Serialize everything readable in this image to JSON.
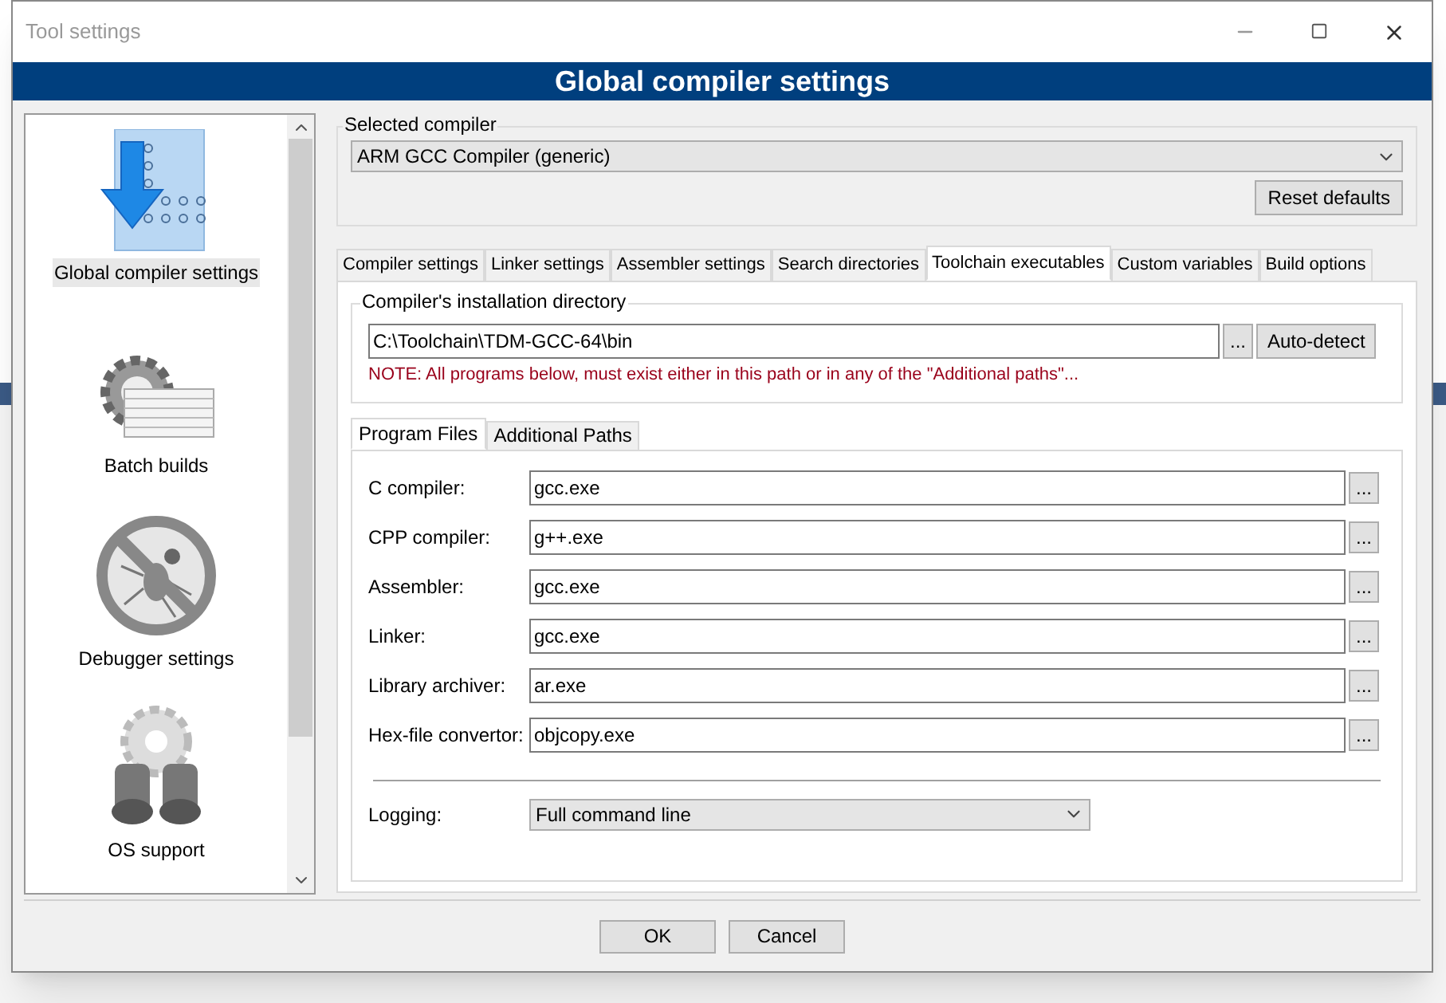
{
  "window": {
    "title": "Tool settings",
    "header": "Global compiler settings"
  },
  "sidebar": {
    "items": [
      {
        "label": "Global compiler settings",
        "kind": "compiler",
        "selected": true
      },
      {
        "label": "Batch builds",
        "kind": "batch",
        "selected": false
      },
      {
        "label": "Debugger settings",
        "kind": "debugger",
        "selected": false
      },
      {
        "label": "OS support",
        "kind": "os",
        "selected": false
      }
    ]
  },
  "selected_compiler": {
    "legend": "Selected compiler",
    "value": "ARM GCC Compiler (generic)",
    "reset_button": "Reset defaults"
  },
  "tabs": [
    {
      "label": "Compiler settings",
      "selected": false
    },
    {
      "label": "Linker settings",
      "selected": false
    },
    {
      "label": "Assembler settings",
      "selected": false
    },
    {
      "label": "Search directories",
      "selected": false
    },
    {
      "label": "Toolchain executables",
      "selected": true
    },
    {
      "label": "Custom variables",
      "selected": false
    },
    {
      "label": "Build options",
      "selected": false
    }
  ],
  "install_dir": {
    "legend": "Compiler's installation directory",
    "value": "C:\\Toolchain\\TDM-GCC-64\\bin",
    "browse_button": "...",
    "autodetect_button": "Auto-detect",
    "note": "NOTE: All programs below, must exist either in this path or in any of the \"Additional paths\"..."
  },
  "subtabs": [
    {
      "label": "Program Files",
      "selected": true
    },
    {
      "label": "Additional Paths",
      "selected": false
    }
  ],
  "programs": [
    {
      "label": "C compiler:",
      "value": "gcc.exe",
      "browse_button": "..."
    },
    {
      "label": "CPP compiler:",
      "value": "g++.exe",
      "browse_button": "..."
    },
    {
      "label": "Assembler:",
      "value": "gcc.exe",
      "browse_button": "..."
    },
    {
      "label": "Linker:",
      "value": "gcc.exe",
      "browse_button": "..."
    },
    {
      "label": "Library archiver:",
      "value": "ar.exe",
      "browse_button": "..."
    },
    {
      "label": "Hex-file convertor:",
      "value": "objcopy.exe",
      "browse_button": "..."
    }
  ],
  "logging": {
    "label": "Logging:",
    "value": "Full command line"
  },
  "buttons": [
    "OK",
    "Cancel"
  ]
}
